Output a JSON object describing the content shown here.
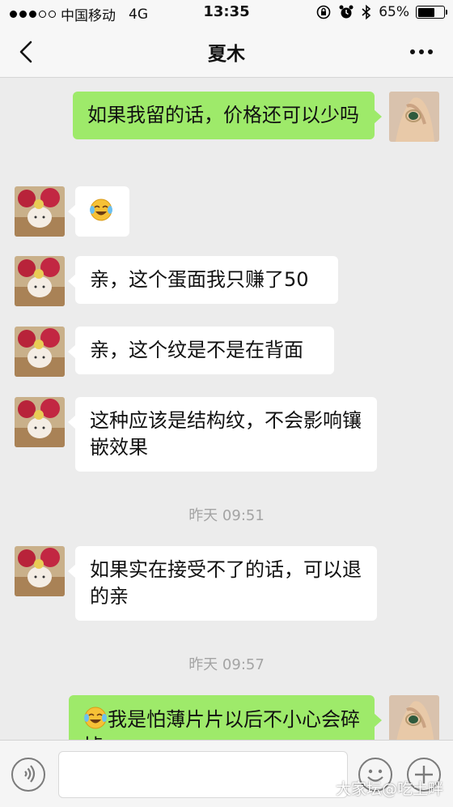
{
  "status_bar": {
    "carrier": "中国移动",
    "network": "4G",
    "time": "13:35",
    "battery": "65%",
    "battery_level": 0.65,
    "signal_bars": 3,
    "signal_max": 5
  },
  "nav": {
    "back_icon": "chevron-left-icon",
    "title": "夏木",
    "more_icon": "more-dots-icon"
  },
  "messages": [
    {
      "side": "out",
      "text": "如果我留的话，价格还可以少吗"
    },
    {
      "side": "in",
      "emoji": "crying-laughing-emoji"
    },
    {
      "side": "in",
      "text": "亲，这个蛋面我只赚了50"
    },
    {
      "side": "in",
      "text": "亲，这个纹是不是在背面"
    },
    {
      "side": "in",
      "text": "这种应该是结构纹，不会影响镶嵌效果"
    },
    {
      "type": "time",
      "text": "昨天 09:51"
    },
    {
      "side": "in",
      "text": "如果实在接受不了的话，可以退的亲"
    },
    {
      "type": "time",
      "text": "昨天 09:57"
    },
    {
      "side": "out",
      "emoji": "crying-laughing-emoji",
      "text": "我是怕薄片片以后不小心会碎掉"
    }
  ],
  "input_bar": {
    "voice_icon": "voice-icon",
    "emoji_icon": "smiley-icon",
    "add_icon": "plus-icon",
    "watermark": "大家坛@吃土畔"
  },
  "colors": {
    "outgoing_bubble": "#9eea6a",
    "incoming_bubble": "#ffffff",
    "background": "#ececec"
  }
}
